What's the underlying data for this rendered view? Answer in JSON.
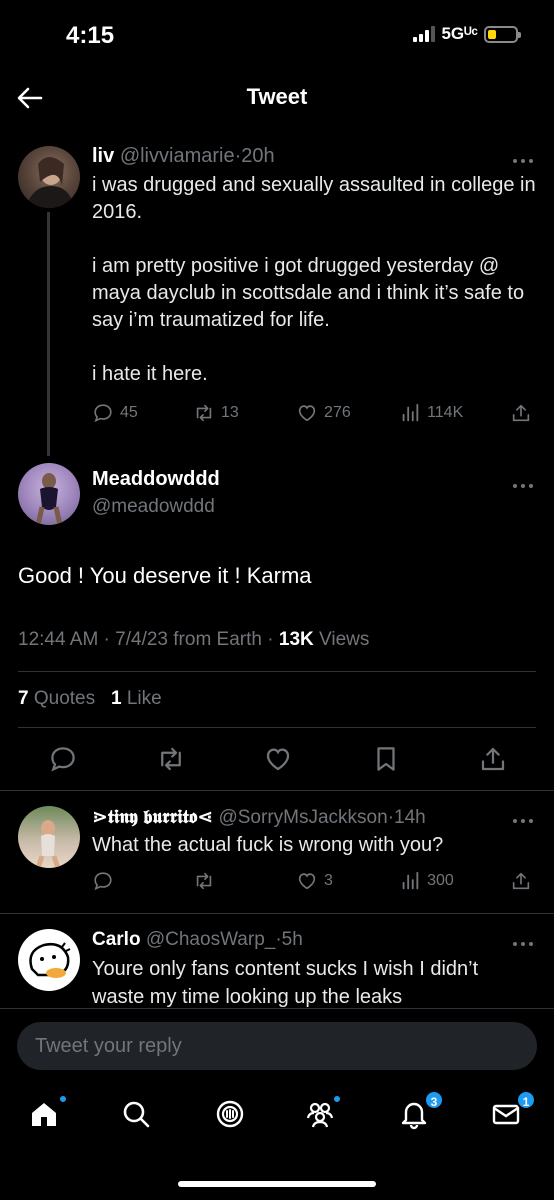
{
  "status": {
    "time": "4:15",
    "network": "5Gᵁᶜ"
  },
  "header": {
    "title": "Tweet"
  },
  "tweet1": {
    "name": "liv",
    "handle": "@livviamarie",
    "age": "20h",
    "body": [
      "i was drugged and sexually assaulted in college in 2016.",
      "i am pretty positive i got drugged yesterday @ maya dayclub in scottsdale and i think it’s safe to say i’m traumatized for life.",
      "i hate it here."
    ],
    "replies": "45",
    "retweets": "13",
    "likes": "276",
    "views": "114K"
  },
  "tweet2": {
    "name": "Meaddowddd",
    "handle": "@meadowddd",
    "body": "Good ! You deserve it ! Karma",
    "time": "12:44 AM",
    "date": "7/4/23",
    "source": "from Earth",
    "views_count": "13K",
    "views_label": "Views",
    "quotes_count": "7",
    "quotes_label": "Quotes",
    "likes_count": "1",
    "likes_label": "Like"
  },
  "reply1": {
    "name": "⋗𝖙𝖎𝖓𝖞 𝖇𝖚𝖗𝖗𝖎𝖙𝖔⋖",
    "handle": "@SorryMsJackkson",
    "age": "14h",
    "body": "What the actual fuck is wrong with you?",
    "likes": "3",
    "views": "300"
  },
  "reply2": {
    "name": "Carlo",
    "handle": "@ChaosWarp_",
    "age": "5h",
    "body": "Youre only fans content sucks I wish I didn’t waste my time looking up the leaks"
  },
  "compose": {
    "placeholder": "Tweet your reply"
  },
  "tabbar": {
    "notifications_badge": "3",
    "messages_badge": "1"
  },
  "colors": {
    "accent": "#1d9bf0",
    "background": "#000000",
    "muted": "#71767b"
  }
}
